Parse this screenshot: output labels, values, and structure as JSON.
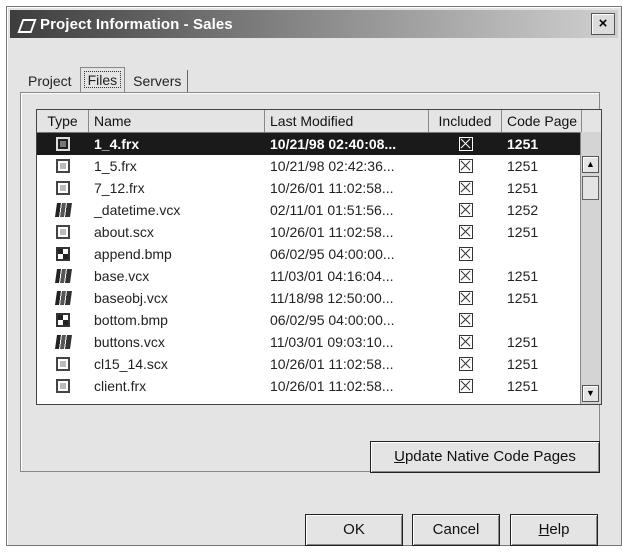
{
  "window": {
    "title": "Project Information - Sales",
    "close_label": "×"
  },
  "tabs": [
    {
      "label": "Project",
      "active": false
    },
    {
      "label": "Files",
      "active": true
    },
    {
      "label": "Servers",
      "active": false
    }
  ],
  "columns": {
    "type": "Type",
    "name": "Name",
    "last_modified": "Last Modified",
    "included": "Included",
    "code_page": "Code Page"
  },
  "files": [
    {
      "icon": "form-icon",
      "name": "1_4.frx",
      "modified": "10/21/98 02:40:08...",
      "included": true,
      "code_page": "1251",
      "selected": true
    },
    {
      "icon": "form-icon",
      "name": "1_5.frx",
      "modified": "10/21/98 02:42:36...",
      "included": true,
      "code_page": "1251"
    },
    {
      "icon": "form-icon",
      "name": "7_12.frx",
      "modified": "10/26/01 11:02:58...",
      "included": true,
      "code_page": "1251"
    },
    {
      "icon": "class-library-icon",
      "name": "_datetime.vcx",
      "modified": "02/11/01 01:51:56...",
      "included": true,
      "code_page": "1252"
    },
    {
      "icon": "form-icon",
      "name": "about.scx",
      "modified": "10/26/01 11:02:58...",
      "included": true,
      "code_page": "1251"
    },
    {
      "icon": "bitmap-icon",
      "name": "append.bmp",
      "modified": "06/02/95 04:00:00...",
      "included": true,
      "code_page": ""
    },
    {
      "icon": "class-library-icon",
      "name": "base.vcx",
      "modified": "11/03/01 04:16:04...",
      "included": true,
      "code_page": "1251"
    },
    {
      "icon": "class-library-icon",
      "name": "baseobj.vcx",
      "modified": "11/18/98 12:50:00...",
      "included": true,
      "code_page": "1251"
    },
    {
      "icon": "bitmap-icon",
      "name": "bottom.bmp",
      "modified": "06/02/95 04:00:00...",
      "included": true,
      "code_page": ""
    },
    {
      "icon": "class-library-icon",
      "name": "buttons.vcx",
      "modified": "11/03/01 09:03:10...",
      "included": true,
      "code_page": "1251"
    },
    {
      "icon": "form-icon",
      "name": "cl15_14.scx",
      "modified": "10/26/01 11:02:58...",
      "included": true,
      "code_page": "1251"
    },
    {
      "icon": "form-icon",
      "name": "client.frx",
      "modified": "10/26/01 11:02:58...",
      "included": true,
      "code_page": "1251"
    }
  ],
  "buttons": {
    "update_prefix": "",
    "update_underline": "U",
    "update_rest": "pdate Native Code Pages",
    "ok": "OK",
    "cancel": "Cancel",
    "help_underline": "H",
    "help_rest": "elp"
  }
}
